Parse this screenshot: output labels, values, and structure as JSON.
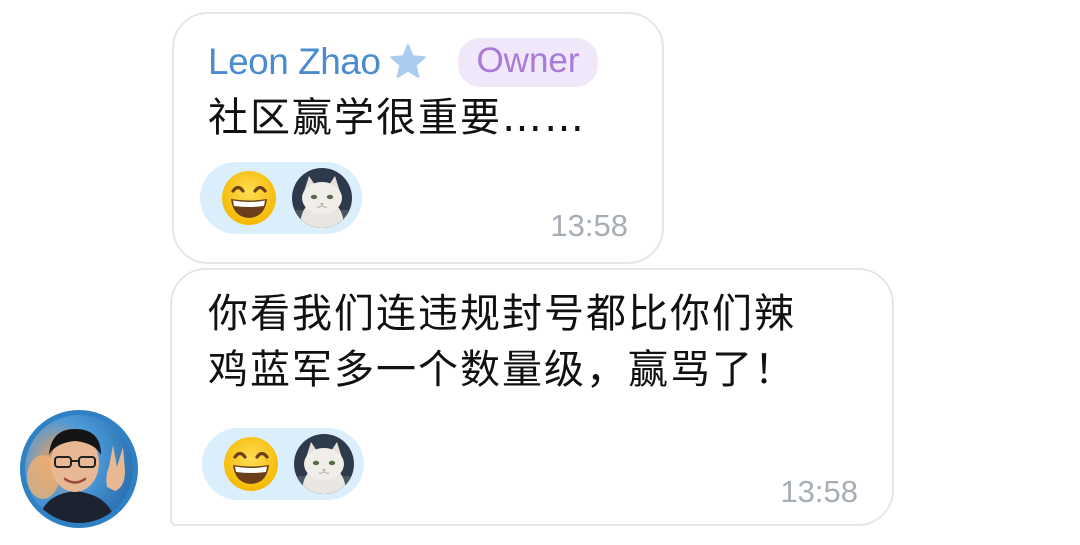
{
  "colors": {
    "sender_name": "#4a8ccf",
    "owner_badge_text": "#a87bd6",
    "owner_badge_bg": "#f1e7fa",
    "reaction_bg": "#dbeefc",
    "timestamp": "#a6adb4",
    "bubble_border": "#e6e6e6"
  },
  "messages": [
    {
      "sender_name": "Leon Zhao",
      "sender_icon": "star-icon",
      "badge": "Owner",
      "text": "社区赢学很重要……",
      "reactions": [
        {
          "type": "emoji",
          "icon": "grinning-face-icon"
        },
        {
          "type": "avatar",
          "icon": "white-cat-avatar"
        }
      ],
      "time": "13:58"
    },
    {
      "text": "你看我们连违规封号都比你们辣\n鸡蓝军多一个数量级，赢骂了！",
      "reactions": [
        {
          "type": "emoji",
          "icon": "grinning-face-icon"
        },
        {
          "type": "avatar",
          "icon": "white-cat-avatar"
        }
      ],
      "time": "13:58"
    }
  ],
  "sender_avatar": {
    "icon": "user-photo-avatar"
  }
}
